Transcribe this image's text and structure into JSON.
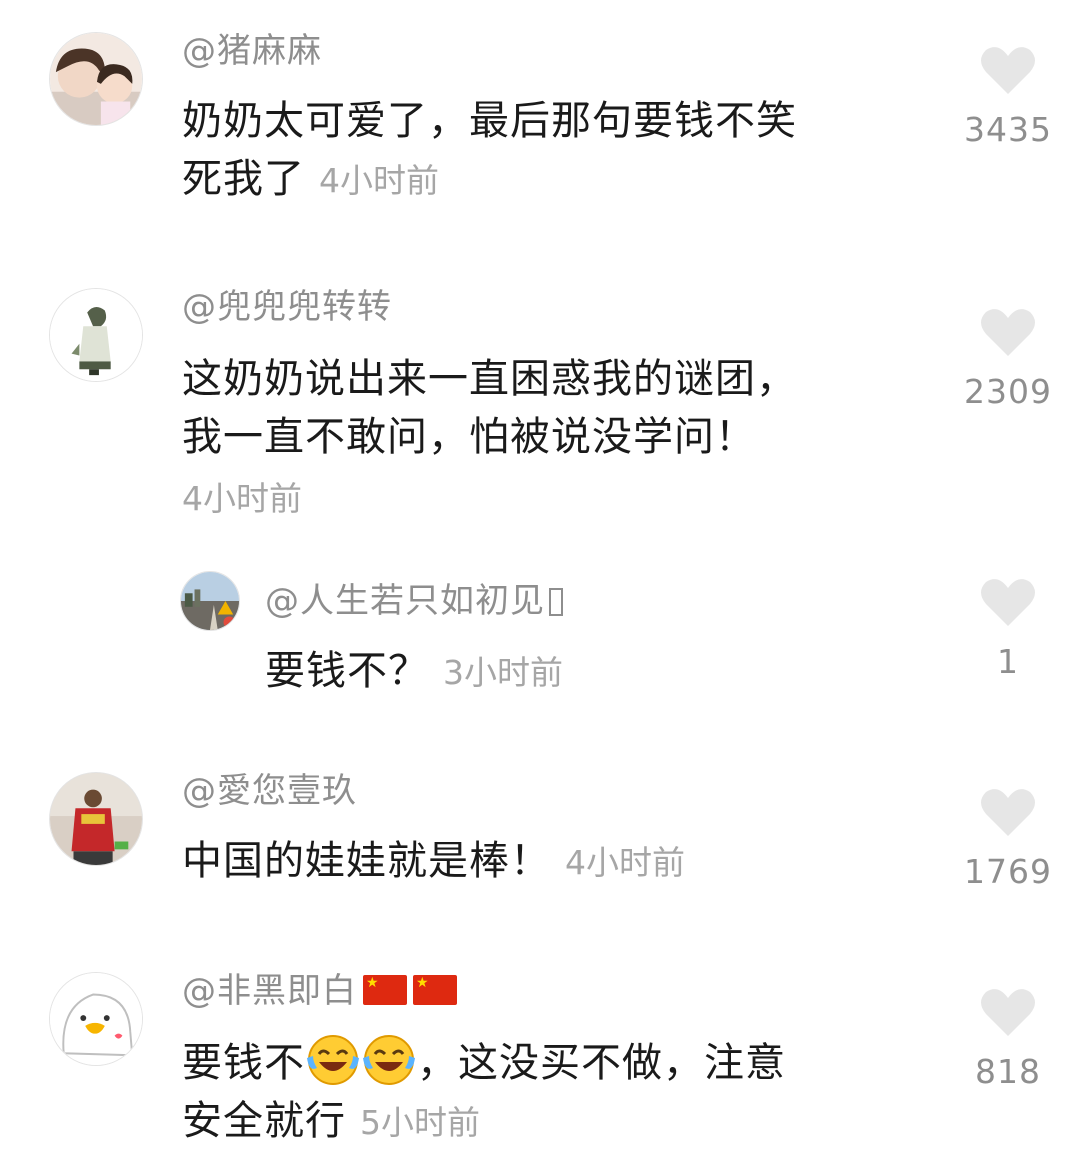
{
  "comments": [
    {
      "username": "@猪麻麻",
      "text_line1": "奶奶太可爱了，最后那句要钱不笑",
      "text_line2": "死我了",
      "time": "4小时前",
      "likes": "3435"
    },
    {
      "username": "@兜兜兜转转",
      "text_line1": "这奶奶说出来一直困惑我的谜团，",
      "text_line2": "我一直不敢问，怕被说没学问！",
      "time": "4小时前",
      "likes": "2309"
    },
    {
      "username": "@人生若只如初见",
      "text": "要钱不？",
      "time": "3小时前",
      "likes": "1"
    },
    {
      "username": "@愛您壹玖",
      "text": "中国的娃娃就是棒！",
      "time": "4小时前",
      "likes": "1769"
    },
    {
      "username": "@非黑即白",
      "text_line1_a": "要钱不",
      "text_line1_b": "，这没买不做，注意",
      "text_line2": "安全就行",
      "time": "5小时前",
      "likes": "818"
    }
  ],
  "icons": {
    "like": "heart-icon",
    "emoji": "crying-laughing-emoji",
    "flag": "china-flag"
  },
  "colors": {
    "username": "#8e8e8e",
    "body_text": "#1a1a1a",
    "time": "#a6a6a6",
    "heart": "#e6e6e6",
    "flag_red": "#de2910",
    "flag_star": "#ffde00"
  }
}
